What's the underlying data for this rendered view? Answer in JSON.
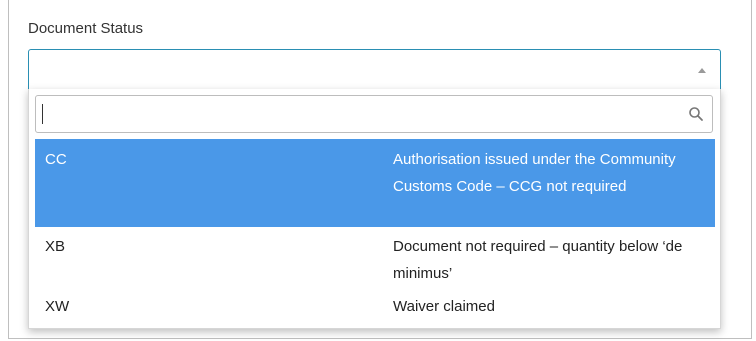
{
  "field": {
    "label": "Document Status",
    "selected_value": ""
  },
  "dropdown": {
    "search_value": "",
    "search_icon": "search-icon",
    "options": [
      {
        "code": "CC",
        "description": "Authorisation issued under the Community Customs Code – CCG not required",
        "selected": true
      },
      {
        "code": "XB",
        "description": "Document not required – quantity below ‘de minimus’",
        "selected": false
      },
      {
        "code": "XW",
        "description": "Waiver claimed",
        "selected": false
      }
    ]
  },
  "colors": {
    "accent_border": "#2a8fb3",
    "selected_bg": "#4a98e8",
    "selected_text": "#ffffff"
  }
}
